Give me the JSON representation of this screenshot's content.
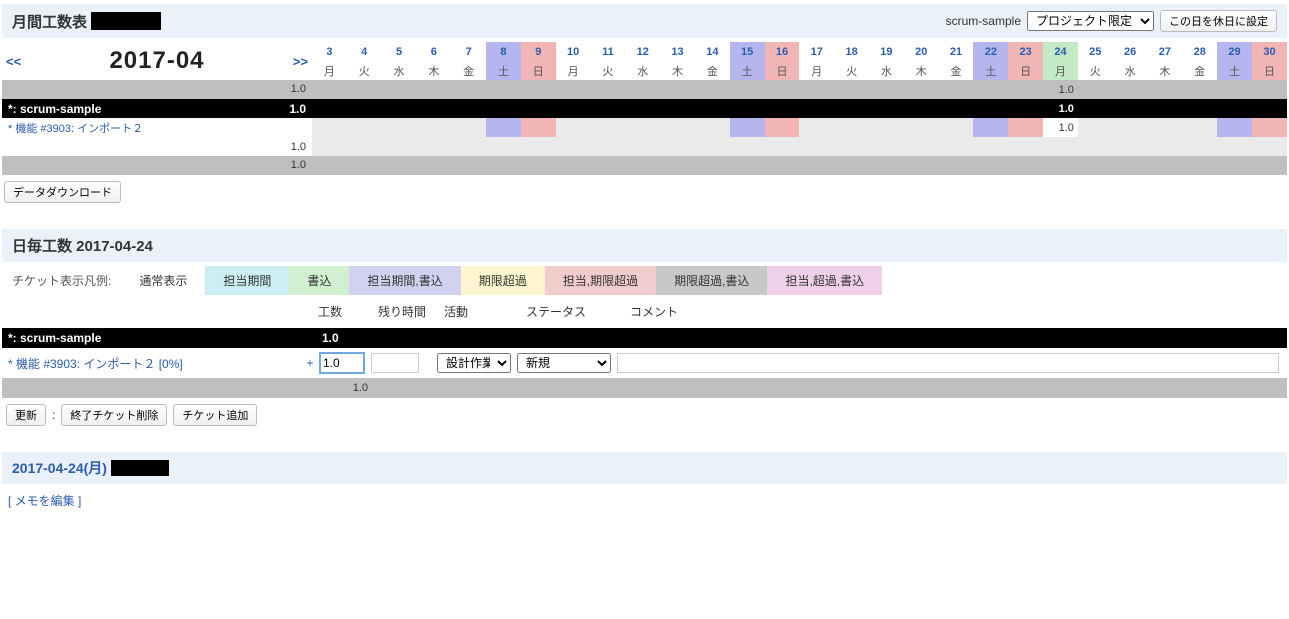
{
  "header": {
    "title": "月間工数表",
    "project_name": "scrum-sample",
    "dropdown_selected": "プロジェクト限定",
    "holiday_button": "この日を休日に設定"
  },
  "calendar": {
    "prev": "<<",
    "next": ">>",
    "month": "2017-04",
    "days": [
      3,
      4,
      5,
      6,
      7,
      8,
      9,
      10,
      11,
      12,
      13,
      14,
      15,
      16,
      17,
      18,
      19,
      20,
      21,
      22,
      23,
      24,
      25,
      26,
      27,
      28,
      29,
      30
    ],
    "dow": [
      "月",
      "火",
      "水",
      "木",
      "金",
      "土",
      "日",
      "月",
      "火",
      "水",
      "木",
      "金",
      "土",
      "日",
      "月",
      "火",
      "水",
      "木",
      "金",
      "土",
      "日",
      "月",
      "火",
      "水",
      "木",
      "金",
      "土",
      "日"
    ],
    "project_row": {
      "name": "*: scrum-sample",
      "total": "1.0",
      "today_val": "1.0"
    },
    "ticket_row": {
      "name": "* 機能 #3903: インポート２",
      "total": "1.0",
      "today_val": "1.0"
    },
    "grand_total_top": "1.0",
    "grand_total_bottom": "1.0",
    "button_download": "データダウンロード"
  },
  "daily": {
    "title": "日毎工数 2017-04-24",
    "legend_label": "チケット表示凡例:",
    "legends": {
      "normal": "通常表示",
      "assigned": "担当期間",
      "written": "書込",
      "assigned_written": "担当期間,書込",
      "overdue": "期限超過",
      "assign_overdue": "担当,期限超過",
      "overdue_written": "期限超過,書込",
      "all": "担当,超過,書込"
    },
    "cols": {
      "hours": "工数",
      "remain": "残り時間",
      "activity": "活動",
      "status": "ステータス",
      "comment": "コメント"
    },
    "project": {
      "name": "*: scrum-sample",
      "hours": "1.0"
    },
    "ticket": {
      "name": "* 機能 #3903: インポート２  [0%]",
      "plus": "+",
      "hours": "1.0",
      "activity_selected": "設計作業",
      "status_selected": "新規"
    },
    "total": "1.0",
    "buttons": {
      "update": "更新",
      "colon": ":",
      "delete": "終了チケット削除",
      "add": "チケット追加"
    }
  },
  "memo": {
    "date": "2017-04-24(月)",
    "edit": "メモを編集",
    "lb": "[ ",
    "rb": " ]"
  }
}
